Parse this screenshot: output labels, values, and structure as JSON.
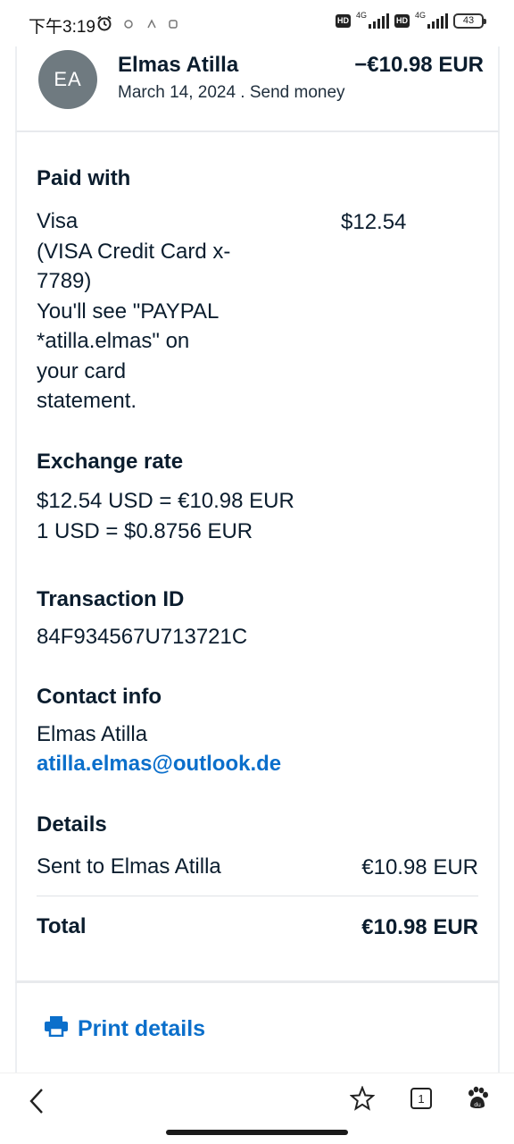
{
  "status_bar": {
    "time": "下午3:19",
    "network_1": "4G",
    "network_2": "4G",
    "hd_label": "HD",
    "battery": "43"
  },
  "header": {
    "avatar_initials": "EA",
    "name": "Elmas Atilla",
    "date_type": "March 14, 2024 . Send money",
    "amount": "−€10.98 EUR"
  },
  "paid_with": {
    "heading": "Paid with",
    "lines": [
      "Visa",
      "(VISA Credit Card x-",
      "7789)",
      "You'll see \"PAYPAL",
      "*atilla.elmas\" on",
      "your card",
      "statement."
    ],
    "amount": "$12.54"
  },
  "exchange_rate": {
    "heading": "Exchange rate",
    "line1": "$12.54 USD = €10.98 EUR",
    "line2": "1 USD = $0.8756 EUR"
  },
  "transaction": {
    "heading": "Transaction ID",
    "id": "84F934567U713721C"
  },
  "contact": {
    "heading": "Contact info",
    "name": "Elmas Atilla",
    "email": "atilla.elmas@outlook.de"
  },
  "details": {
    "heading": "Details",
    "sent_label": "Sent to Elmas Atilla",
    "sent_amount": "€10.98 EUR",
    "total_label": "Total",
    "total_amount": "€10.98 EUR"
  },
  "print": {
    "label": "Print details"
  },
  "browser_bar": {
    "tab_count": "1"
  },
  "colors": {
    "link": "#0b6fcb",
    "text": "#0b1d2e",
    "avatar": "#6f7a80"
  }
}
